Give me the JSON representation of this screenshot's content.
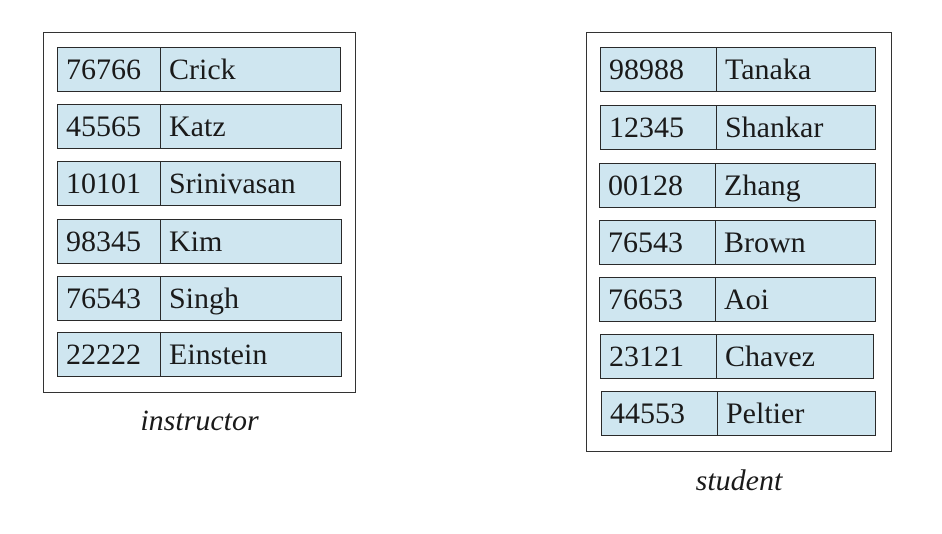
{
  "relations": {
    "instructor": {
      "caption": "instructor",
      "rows": [
        {
          "id": "76766",
          "name": "Crick"
        },
        {
          "id": "45565",
          "name": "Katz"
        },
        {
          "id": "10101",
          "name": "Srinivasan"
        },
        {
          "id": "98345",
          "name": "Kim"
        },
        {
          "id": "76543",
          "name": "Singh"
        },
        {
          "id": "22222",
          "name": "Einstein"
        }
      ]
    },
    "student": {
      "caption": "student",
      "rows": [
        {
          "id": "98988",
          "name": "Tanaka"
        },
        {
          "id": "12345",
          "name": "Shankar"
        },
        {
          "id": "00128",
          "name": "Zhang"
        },
        {
          "id": "76543",
          "name": "Brown"
        },
        {
          "id": "76653",
          "name": "Aoi"
        },
        {
          "id": "23121",
          "name": "Chavez"
        },
        {
          "id": "44553",
          "name": "Peltier"
        }
      ]
    }
  },
  "colors": {
    "cell_fill": "#cfe6f0",
    "border": "#2a2a2a"
  }
}
